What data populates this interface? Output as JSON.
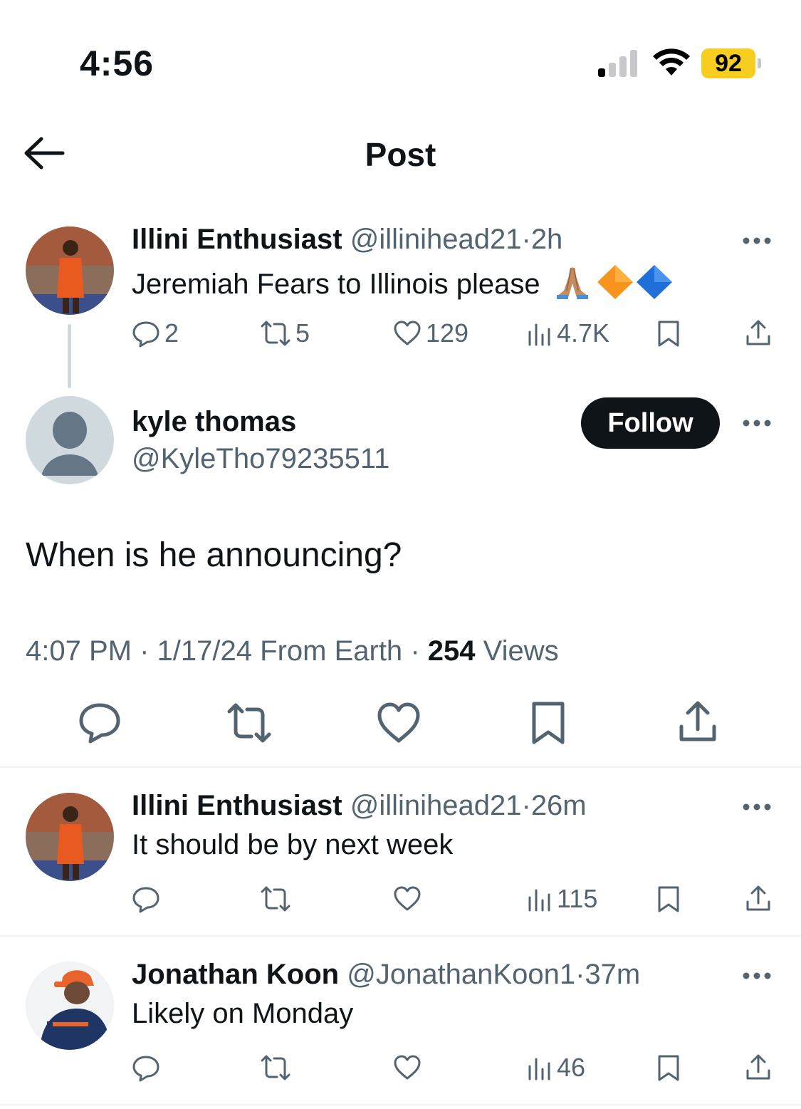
{
  "status_bar": {
    "time": "4:56",
    "battery": "92"
  },
  "header": {
    "title": "Post"
  },
  "parent_tweet": {
    "display_name": "Illini Enthusiast",
    "handle": "@illinihead21",
    "separator": "·",
    "age": "2h",
    "text": "Jeremiah Fears to Illinois please",
    "emojis": [
      "folded-hands",
      "orange-diamond",
      "blue-diamond"
    ],
    "replies": "2",
    "reposts": "5",
    "likes": "129",
    "views": "4.7K"
  },
  "main_tweet": {
    "display_name": "kyle thomas",
    "handle": "@KyleTho79235511",
    "follow_label": "Follow",
    "text": "When is he announcing?",
    "time": "4:07 PM",
    "date": "1/17/24",
    "source": "From Earth",
    "separator": "·",
    "views_count": "254",
    "views_label": "Views"
  },
  "replies": [
    {
      "display_name": "Illini Enthusiast",
      "handle": "@illinihead21",
      "separator": "·",
      "age": "26m",
      "text": "It should be by next week",
      "views": "115"
    },
    {
      "display_name": "Jonathan Koon",
      "handle": "@JonathanKoon1",
      "separator": "·",
      "age": "37m",
      "text": "Likely on Monday",
      "views": "46"
    }
  ],
  "colors": {
    "text_primary": "#0f1419",
    "text_secondary": "#536471",
    "battery": "#f7cd1f",
    "divider": "#eff3f4"
  }
}
